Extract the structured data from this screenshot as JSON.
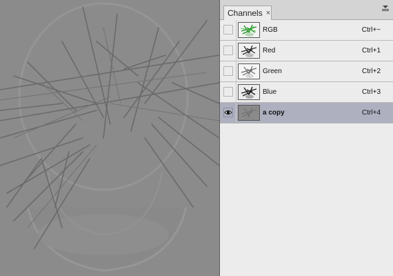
{
  "panel": {
    "tab_label": "Channels",
    "close_glyph": "×",
    "menu_icon": "panel-menu-icon"
  },
  "channels": [
    {
      "name": "RGB",
      "shortcut": "Ctrl+~",
      "thumb": "rgb",
      "visible": false,
      "selected": false
    },
    {
      "name": "Red",
      "shortcut": "Ctrl+1",
      "thumb": "red",
      "visible": false,
      "selected": false
    },
    {
      "name": "Green",
      "shortcut": "Ctrl+2",
      "thumb": "green",
      "visible": false,
      "selected": false
    },
    {
      "name": "Blue",
      "shortcut": "Ctrl+3",
      "thumb": "blue",
      "visible": false,
      "selected": false
    },
    {
      "name": "a copy",
      "shortcut": "Ctrl+4",
      "thumb": "alpha",
      "visible": true,
      "selected": true
    }
  ],
  "colors": {
    "selected_row": "#aeb0c0",
    "panel_bg": "#ececec",
    "canvas_gray": "#8b8b8b"
  }
}
